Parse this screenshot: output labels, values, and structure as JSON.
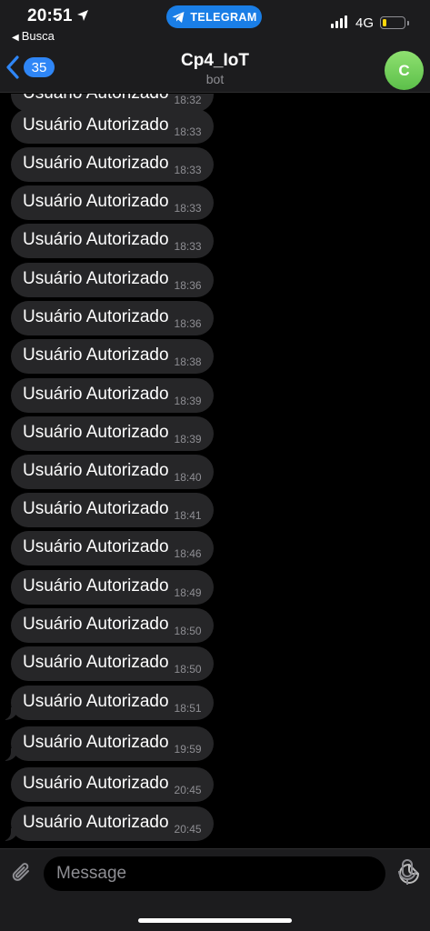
{
  "status_bar": {
    "time": "20:51",
    "back_app": "Busca",
    "pill_label": "TELEGRAM",
    "network": "4G",
    "battery_level": 0.2,
    "pill_color": "#1a7ee6"
  },
  "nav": {
    "unread_count": "35",
    "title": "Cp4_IoT",
    "subtitle": "bot",
    "avatar_letter": "C",
    "accent": "#2f86f6"
  },
  "messages": [
    {
      "text": "Usuário Autorizado",
      "time": "18:32"
    },
    {
      "text": "Usuário Autorizado",
      "time": "18:33"
    },
    {
      "text": "Usuário Autorizado",
      "time": "18:33"
    },
    {
      "text": "Usuário Autorizado",
      "time": "18:33"
    },
    {
      "text": "Usuário Autorizado",
      "time": "18:33"
    },
    {
      "text": "Usuário Autorizado",
      "time": "18:36"
    },
    {
      "text": "Usuário Autorizado",
      "time": "18:36"
    },
    {
      "text": "Usuário Autorizado",
      "time": "18:38"
    },
    {
      "text": "Usuário Autorizado",
      "time": "18:39"
    },
    {
      "text": "Usuário Autorizado",
      "time": "18:39"
    },
    {
      "text": "Usuário Autorizado",
      "time": "18:40"
    },
    {
      "text": "Usuário Autorizado",
      "time": "18:41"
    },
    {
      "text": "Usuário Autorizado",
      "time": "18:46"
    },
    {
      "text": "Usuário Autorizado",
      "time": "18:49"
    },
    {
      "text": "Usuário Autorizado",
      "time": "18:50"
    },
    {
      "text": "Usuário Autorizado",
      "time": "18:50"
    },
    {
      "text": "Usuário Autorizado",
      "time": "18:51"
    },
    {
      "text": "Usuário Autorizado",
      "time": "19:59"
    },
    {
      "text": "Usuário Autorizado",
      "time": "20:45"
    },
    {
      "text": "Usuário Autorizado",
      "time": "20:45"
    }
  ],
  "input": {
    "placeholder": "Message",
    "icons": [
      "paperclip-icon",
      "sticker-icon",
      "microphone-icon"
    ]
  }
}
